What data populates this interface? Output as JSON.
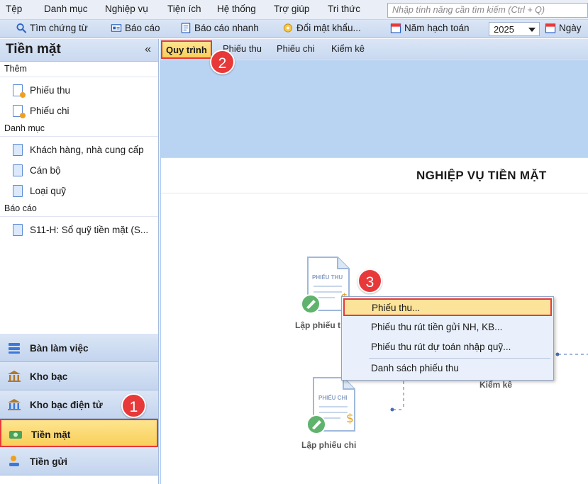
{
  "menubar": {
    "items": [
      "Tệp",
      "Danh mục",
      "Nghiệp vụ",
      "Tiện ích",
      "Hệ thống",
      "Trợ giúp",
      "Tri thức"
    ],
    "search_placeholder": "Nhập tính năng cần tìm kiếm (Ctrl + Q)"
  },
  "toolbar": {
    "search_voucher": "Tìm chứng từ",
    "report": "Báo cáo",
    "quick_report": "Báo cáo nhanh",
    "change_password": "Đổi mật khẩu...",
    "fiscal_year_label": "Năm hạch toán",
    "fiscal_year_value": "2025",
    "date_label": "Ngày"
  },
  "left_panel": {
    "title": "Tiền mặt",
    "collapse": "«",
    "groups": {
      "add": {
        "label": "Thêm",
        "items": [
          "Phiếu thu",
          "Phiếu chi"
        ]
      },
      "catalog": {
        "label": "Danh mục",
        "items": [
          "Khách hàng, nhà cung cấp",
          "Cán bộ",
          "Loại quỹ"
        ]
      },
      "report": {
        "label": "Báo cáo",
        "items": [
          "S11-H: Sổ quỹ tiền mặt (S..."
        ]
      }
    },
    "splitter": "•••••••••",
    "nav": [
      "Bàn làm việc",
      "Kho bạc",
      "Kho bạc điện tử",
      "Tiền mặt",
      "Tiền gửi"
    ]
  },
  "tabs": [
    "Quy trình",
    "Phiếu thu",
    "Phiếu chi",
    "Kiểm kê"
  ],
  "process": {
    "title": "NGHIỆP VỤ TIỀN MẶT",
    "receipt_doc": "PHIẾU THU",
    "receipt_label": "Lập phiếu t",
    "payment_doc": "PHIẾU CHI",
    "payment_label": "Lập phiếu chi",
    "inventory_label": "Kiểm kê"
  },
  "context_menu": {
    "items": [
      "Phiếu thu...",
      "Phiếu thu rút tiền gửi NH, KB...",
      "Phiếu thu rút dự toán nhập quỹ...",
      "Danh sách phiếu thu"
    ]
  },
  "badges": [
    "1",
    "2",
    "3"
  ],
  "colors": {
    "highlight": "#fbe49a",
    "callout": "#e8393a",
    "panel": "#c9d9f0",
    "workspace": "#b9d3f2"
  }
}
